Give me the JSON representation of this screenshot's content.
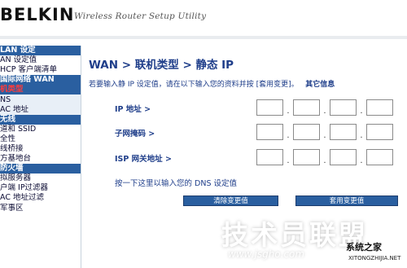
{
  "header": {
    "brand": "BELKIN",
    "tagline": "Wireless Router Setup Utility"
  },
  "sidebar": {
    "items": [
      {
        "label": "LAN 设定",
        "type": "header"
      },
      {
        "label": "AN 设定值",
        "type": "item"
      },
      {
        "label": "HCP 客户端清单",
        "type": "item"
      },
      {
        "label": "国际网络 WAN",
        "type": "header"
      },
      {
        "label": "机类型",
        "type": "item",
        "active": true
      },
      {
        "label": "NS",
        "type": "item"
      },
      {
        "label": "AC 地址",
        "type": "item"
      },
      {
        "label": "无线",
        "type": "header"
      },
      {
        "label": "道和 SSID",
        "type": "item"
      },
      {
        "label": "全性",
        "type": "item"
      },
      {
        "label": "线桥接",
        "type": "item"
      },
      {
        "label": "方基地台",
        "type": "item"
      },
      {
        "label": "防火墙",
        "type": "header"
      },
      {
        "label": "拟服务器",
        "type": "item"
      },
      {
        "label": "户端 IP过滤器",
        "type": "item"
      },
      {
        "label": "AC 地址过滤",
        "type": "item"
      },
      {
        "label": "军事区",
        "type": "item"
      }
    ]
  },
  "main": {
    "title": "WAN > 联机类型 > 静态 IP",
    "instruction_text": "若要输入静 IP 设定值，请在以下输入您的资料并按 [套用变更]。",
    "help_link": "其它信息",
    "fields": [
      {
        "label": "IP 地址 >",
        "values": [
          "",
          "",
          "",
          ""
        ]
      },
      {
        "label": "子网掩码 >",
        "values": [
          "",
          "",
          "",
          ""
        ]
      },
      {
        "label": "ISP 网关地址 >",
        "values": [
          "",
          "",
          "",
          ""
        ]
      }
    ],
    "dns_link": "按一下这里以输入您的 DNS 设定值",
    "buttons": {
      "clear": "清除变更值",
      "apply": "套用变更值"
    }
  },
  "watermark": {
    "text": "技术员联盟",
    "url": "www.jsgho.com",
    "corner_label": "系统之家",
    "corner_sub": "XITONGZHIJIA.NET"
  },
  "colors": {
    "sidebar_header_bg": "#2a5fa0",
    "sidebar_active_text": "#ff3b3b",
    "main_text": "#1f3e8a",
    "button_bg": "#2a5fa0"
  }
}
